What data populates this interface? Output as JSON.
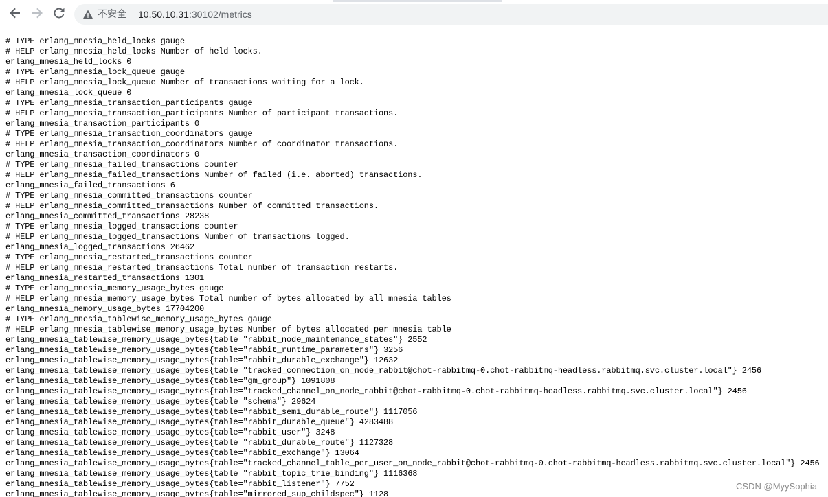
{
  "browser": {
    "security_label": "不安全",
    "url_host": "10.50.10.31",
    "url_path": ":30102/metrics"
  },
  "icons": {
    "back": "back-arrow-icon",
    "forward": "forward-arrow-icon",
    "reload": "reload-icon",
    "security": "warning-triangle-icon"
  },
  "metrics_lines": [
    "# TYPE erlang_mnesia_held_locks gauge",
    "# HELP erlang_mnesia_held_locks Number of held locks.",
    "erlang_mnesia_held_locks 0",
    "# TYPE erlang_mnesia_lock_queue gauge",
    "# HELP erlang_mnesia_lock_queue Number of transactions waiting for a lock.",
    "erlang_mnesia_lock_queue 0",
    "# TYPE erlang_mnesia_transaction_participants gauge",
    "# HELP erlang_mnesia_transaction_participants Number of participant transactions.",
    "erlang_mnesia_transaction_participants 0",
    "# TYPE erlang_mnesia_transaction_coordinators gauge",
    "# HELP erlang_mnesia_transaction_coordinators Number of coordinator transactions.",
    "erlang_mnesia_transaction_coordinators 0",
    "# TYPE erlang_mnesia_failed_transactions counter",
    "# HELP erlang_mnesia_failed_transactions Number of failed (i.e. aborted) transactions.",
    "erlang_mnesia_failed_transactions 6",
    "# TYPE erlang_mnesia_committed_transactions counter",
    "# HELP erlang_mnesia_committed_transactions Number of committed transactions.",
    "erlang_mnesia_committed_transactions 28238",
    "# TYPE erlang_mnesia_logged_transactions counter",
    "# HELP erlang_mnesia_logged_transactions Number of transactions logged.",
    "erlang_mnesia_logged_transactions 26462",
    "# TYPE erlang_mnesia_restarted_transactions counter",
    "# HELP erlang_mnesia_restarted_transactions Total number of transaction restarts.",
    "erlang_mnesia_restarted_transactions 1301",
    "# TYPE erlang_mnesia_memory_usage_bytes gauge",
    "# HELP erlang_mnesia_memory_usage_bytes Total number of bytes allocated by all mnesia tables",
    "erlang_mnesia_memory_usage_bytes 17704200",
    "# TYPE erlang_mnesia_tablewise_memory_usage_bytes gauge",
    "# HELP erlang_mnesia_tablewise_memory_usage_bytes Number of bytes allocated per mnesia table",
    "erlang_mnesia_tablewise_memory_usage_bytes{table=\"rabbit_node_maintenance_states\"} 2552",
    "erlang_mnesia_tablewise_memory_usage_bytes{table=\"rabbit_runtime_parameters\"} 3256",
    "erlang_mnesia_tablewise_memory_usage_bytes{table=\"rabbit_durable_exchange\"} 12632",
    "erlang_mnesia_tablewise_memory_usage_bytes{table=\"tracked_connection_on_node_rabbit@chot-rabbitmq-0.chot-rabbitmq-headless.rabbitmq.svc.cluster.local\"} 2456",
    "erlang_mnesia_tablewise_memory_usage_bytes{table=\"gm_group\"} 1091808",
    "erlang_mnesia_tablewise_memory_usage_bytes{table=\"tracked_channel_on_node_rabbit@chot-rabbitmq-0.chot-rabbitmq-headless.rabbitmq.svc.cluster.local\"} 2456",
    "erlang_mnesia_tablewise_memory_usage_bytes{table=\"schema\"} 29624",
    "erlang_mnesia_tablewise_memory_usage_bytes{table=\"rabbit_semi_durable_route\"} 1117056",
    "erlang_mnesia_tablewise_memory_usage_bytes{table=\"rabbit_durable_queue\"} 4283488",
    "erlang_mnesia_tablewise_memory_usage_bytes{table=\"rabbit_user\"} 3248",
    "erlang_mnesia_tablewise_memory_usage_bytes{table=\"rabbit_durable_route\"} 1127328",
    "erlang_mnesia_tablewise_memory_usage_bytes{table=\"rabbit_exchange\"} 13064",
    "erlang_mnesia_tablewise_memory_usage_bytes{table=\"tracked_channel_table_per_user_on_node_rabbit@chot-rabbitmq-0.chot-rabbitmq-headless.rabbitmq.svc.cluster.local\"} 2456",
    "erlang_mnesia_tablewise_memory_usage_bytes{table=\"rabbit_topic_trie_binding\"} 1116368",
    "erlang_mnesia_tablewise_memory_usage_bytes{table=\"rabbit_listener\"} 7752",
    "erlang_mnesia_tablewise_memory_usage_bytes{table=\"mirrored_sup_childspec\"} 1128"
  ],
  "watermark": "CSDN @MyySophia"
}
